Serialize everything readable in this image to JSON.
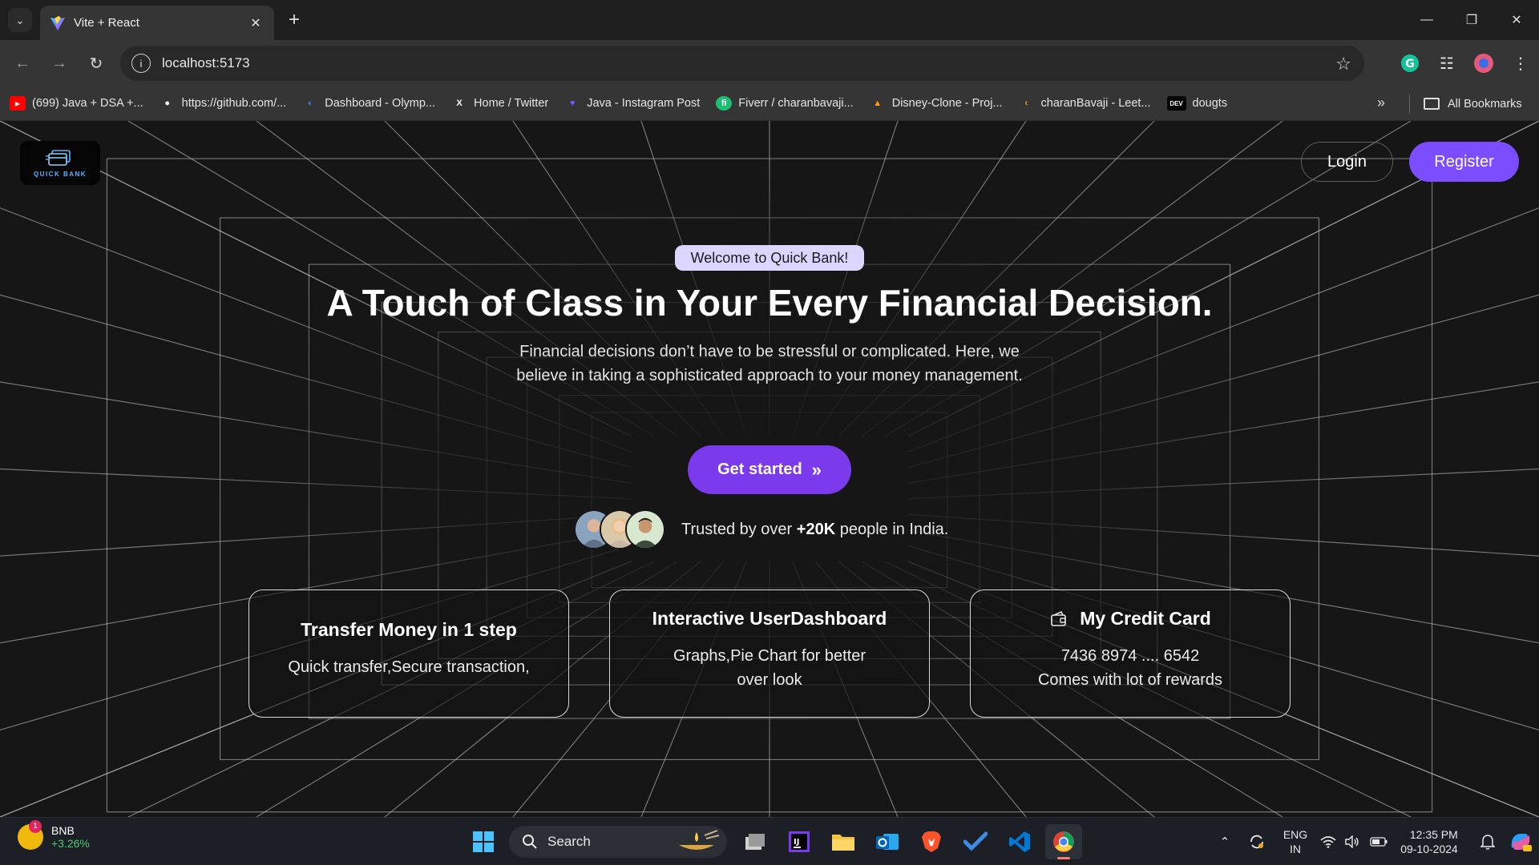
{
  "browser": {
    "tab_title": "Vite + React",
    "url": "localhost:5173",
    "bookmarks": [
      {
        "label": "(699) Java + DSA +...",
        "icon": "youtube-icon",
        "color": "#ff0000"
      },
      {
        "label": "https://github.com/...",
        "icon": "github-icon",
        "color": "#ffffff"
      },
      {
        "label": "Dashboard - Olymp...",
        "icon": "olymp-icon",
        "color": "#3b82f6"
      },
      {
        "label": "Home / Twitter",
        "icon": "x-icon",
        "color": "#ffffff"
      },
      {
        "label": "Java - Instagram Post",
        "icon": "heart-shield-icon",
        "color": "#6d5dfc"
      },
      {
        "label": "Fiverr / charanbavaji...",
        "icon": "fiverr-icon",
        "color": "#1dbf73"
      },
      {
        "label": "Disney-Clone - Proj...",
        "icon": "firebase-icon",
        "color": "#ffa000"
      },
      {
        "label": "charanBavaji - Leet...",
        "icon": "leetcode-icon",
        "color": "#ffa116"
      },
      {
        "label": "dougts",
        "icon": "dev-icon",
        "color": "#ffffff"
      }
    ],
    "all_bookmarks": "All Bookmarks"
  },
  "page": {
    "logo_text": "QUICK BANK",
    "login": "Login",
    "register": "Register",
    "welcome": "Welcome to Quick Bank!",
    "title": "A Touch of Class in Your Every Financial Decision.",
    "subtitle": "Financial decisions don’t have to be stressful or complicated. Here, we believe in taking a sophisticated approach to your money management.",
    "cta": "Get started",
    "trusted_prefix": "Trusted by over ",
    "trusted_count": "+20K",
    "trusted_suffix": " people in India.",
    "cards": [
      {
        "title": "Transfer Money in 1 step",
        "body": "Quick transfer,Secure transaction,"
      },
      {
        "title": "Interactive UserDashboard",
        "body": "Graphs,Pie Chart for better over look"
      },
      {
        "title": "My Credit Card",
        "body_line1": "7436 8974 .... 6542",
        "body_line2": "Comes with lot of rewards"
      }
    ],
    "accent": "#7c3aed"
  },
  "taskbar": {
    "widget_name": "BNB",
    "widget_change": "+3.26%",
    "widget_badge": "1",
    "search": "Search",
    "lang1": "ENG",
    "lang2": "IN",
    "time": "12:35 PM",
    "date": "09-10-2024"
  }
}
